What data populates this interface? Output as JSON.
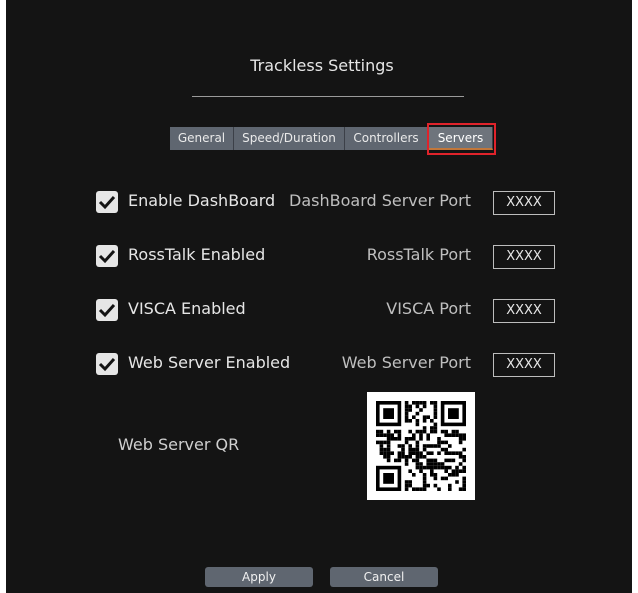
{
  "title": "Trackless Settings",
  "tabs": [
    {
      "label": "General"
    },
    {
      "label": "Speed/Duration"
    },
    {
      "label": "Controllers"
    },
    {
      "label": "Servers"
    }
  ],
  "active_tab": "Servers",
  "settings": [
    {
      "checkbox_label": "Enable DashBoard",
      "checked": true,
      "port_label": "DashBoard Server Port",
      "port_value": "XXXX"
    },
    {
      "checkbox_label": "RossTalk Enabled",
      "checked": true,
      "port_label": "RossTalk Port",
      "port_value": "XXXX"
    },
    {
      "checkbox_label": "VISCA Enabled",
      "checked": true,
      "port_label": "VISCA Port",
      "port_value": "XXXX"
    },
    {
      "checkbox_label": "Web Server Enabled",
      "checked": true,
      "port_label": "Web Server Port",
      "port_value": "XXXX"
    }
  ],
  "qr": {
    "label": "Web Server QR"
  },
  "buttons": {
    "apply": "Apply",
    "cancel": "Cancel"
  },
  "colors": {
    "background": "#141414",
    "tab": "#5f6670",
    "active_tab_underline": "#c2773a",
    "highlight_box": "#e0232b"
  }
}
